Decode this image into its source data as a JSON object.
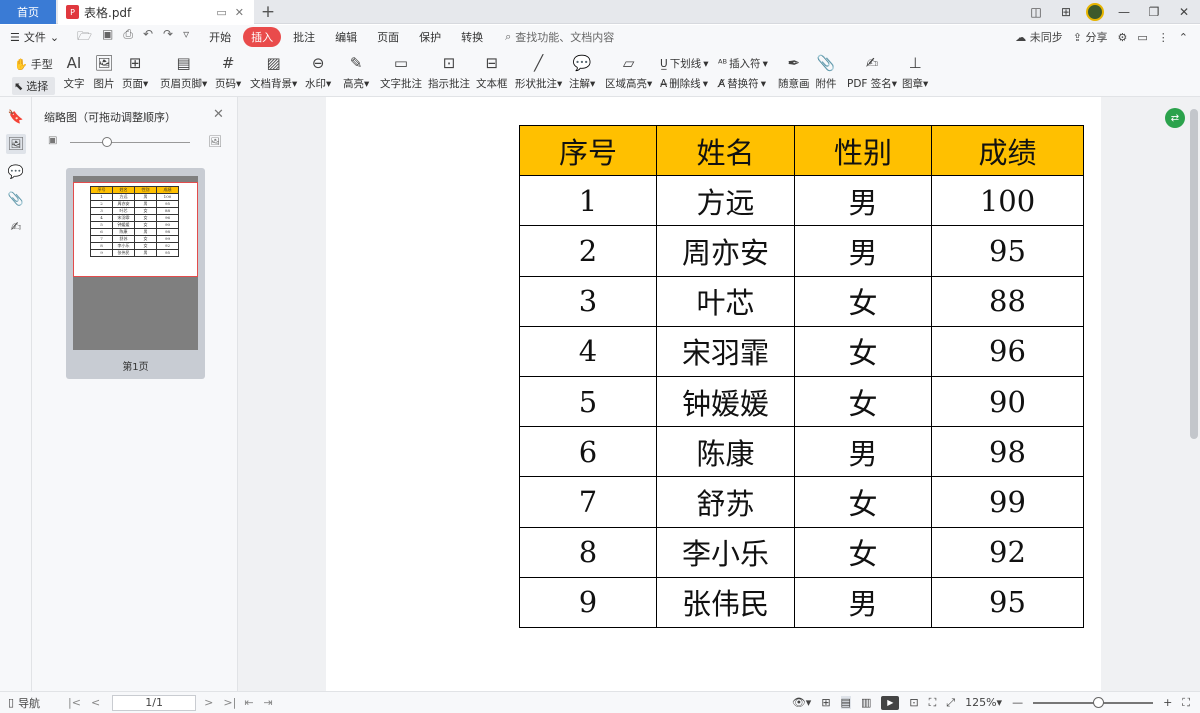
{
  "tabs": {
    "home": "首页",
    "file": "表格.pdf"
  },
  "menu": {
    "file": "文件",
    "tabs": [
      "开始",
      "插入",
      "批注",
      "编辑",
      "页面",
      "保护",
      "转换"
    ],
    "active_tab": "插入",
    "search_placeholder": "查找功能、文档内容",
    "sync": "未同步",
    "share": "分享"
  },
  "ribbon": {
    "hand": "手型",
    "select": "选择",
    "text": "文字",
    "image": "图片",
    "page": "页面",
    "header_footer": "页眉页脚",
    "page_number": "页码",
    "doc_background": "文档背景",
    "watermark": "水印",
    "highlight": "高亮",
    "text_comment": "文字批注",
    "pointer_comment": "指示批注",
    "textbox": "文本框",
    "shape_comment": "形状批注",
    "note": "注解",
    "area_highlight": "区域高亮",
    "underline": "下划线",
    "strikethrough": "删除线",
    "insert_char": "插入符",
    "replace_char": "替换符",
    "freehand": "随意画",
    "attachment": "附件",
    "pdf_sign": "PDF 签名",
    "stamp": "图章"
  },
  "thumbnail_panel": {
    "title": "缩略图（可拖动调整顺序）",
    "page_label": "第1页"
  },
  "table": {
    "headers": [
      "序号",
      "姓名",
      "性别",
      "成绩"
    ],
    "rows": [
      [
        "1",
        "方远",
        "男",
        "100"
      ],
      [
        "2",
        "周亦安",
        "男",
        "95"
      ],
      [
        "3",
        "叶芯",
        "女",
        "88"
      ],
      [
        "4",
        "宋羽霏",
        "女",
        "96"
      ],
      [
        "5",
        "钟媛媛",
        "女",
        "90"
      ],
      [
        "6",
        "陈康",
        "男",
        "98"
      ],
      [
        "7",
        "舒苏",
        "女",
        "99"
      ],
      [
        "8",
        "李小乐",
        "女",
        "92"
      ],
      [
        "9",
        "张伟民",
        "男",
        "95"
      ]
    ],
    "header_color": "#ffc000"
  },
  "statusbar": {
    "nav": "导航",
    "page_indicator": "1/1",
    "zoom": "125%"
  },
  "colors": {
    "accent": "#e94b4b",
    "home_tab": "#3a7bd5"
  }
}
